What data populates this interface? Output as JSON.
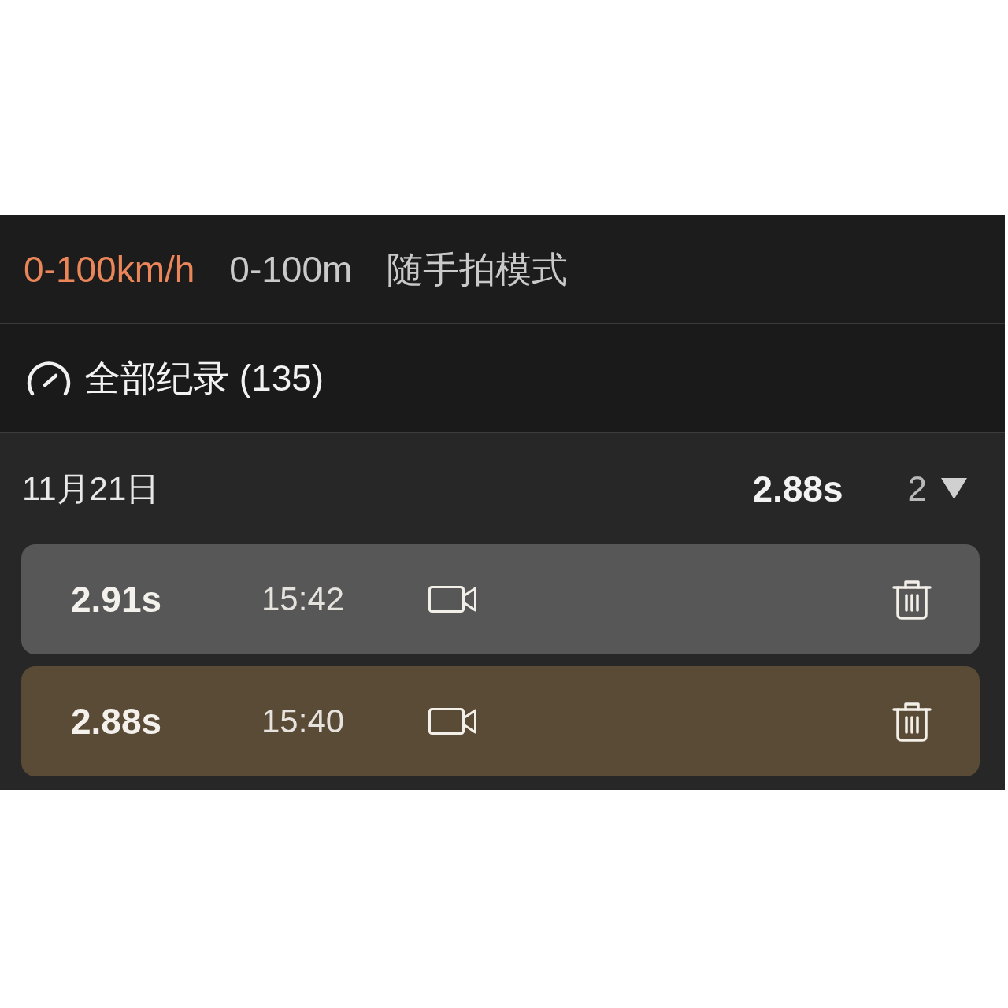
{
  "tabs": [
    {
      "label": "0-100km/h",
      "selected": true
    },
    {
      "label": "0-100m",
      "selected": false
    },
    {
      "label": "随手拍模式",
      "selected": false
    }
  ],
  "records_header": {
    "label": "全部纪录 (135)"
  },
  "groups": [
    {
      "date": "11月21日",
      "best_time": "2.88s",
      "count": "2",
      "expanded": true,
      "records": [
        {
          "time": "2.91s",
          "clock": "15:42",
          "best": false
        },
        {
          "time": "2.88s",
          "clock": "15:40",
          "best": true
        }
      ]
    }
  ]
}
